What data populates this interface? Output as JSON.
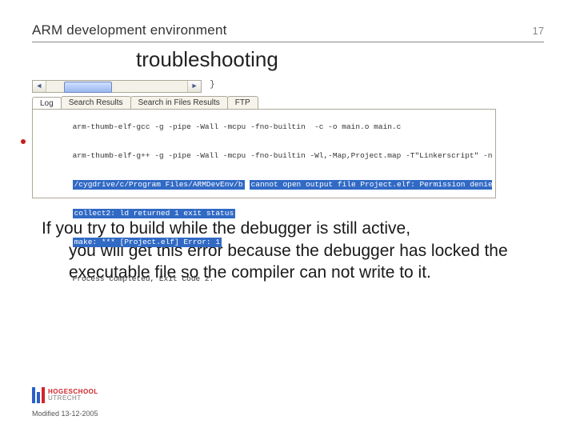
{
  "header": {
    "title": "ARM development environment",
    "page_number": "17"
  },
  "subtitle": "troubleshooting",
  "screenshot": {
    "brace": "}",
    "tabs": [
      "Log",
      "Search Results",
      "Search in Files Results",
      "FTP"
    ],
    "active_tab": 0,
    "log": {
      "l1a": "arm-thumb-elf-gcc -g -pipe -Wall -mcpu",
      "l1b": "-fno-builtin  -c -o main.o main.c",
      "l2a": "arm-thumb-elf-g++ -g -pipe -Wall -mcpu",
      "l2b": "-fno-builtin -Wl,-Map,Project.map -T\"Linkerscript\" -nostar",
      "l3a": "/cygdrive/c/Program Files/ARMDevEnv/b",
      "l3b": "cannot open output file Project.elf: Permission denied",
      "l4": "collect2: ld returned 1 exit status",
      "l5": "make: *** [Project.elf] Error: 1",
      "l6": "Process completed, Exit Code 2."
    }
  },
  "body": {
    "first": "If you try to build while the debugger is still active,",
    "rest": "you will get this error because the debugger has locked the executable file so the compiler can not write to it."
  },
  "logo": {
    "line1": "HOGESCHOOL",
    "line2": "UTRECHT"
  },
  "footer_date": "Modified 13-12-2005"
}
